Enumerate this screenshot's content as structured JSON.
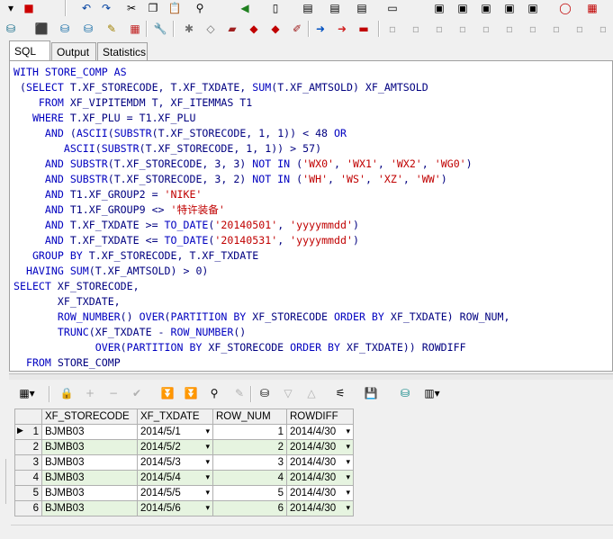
{
  "tabs": [
    "SQL",
    "Output",
    "Statistics"
  ],
  "active_tab": "SQL",
  "sql_lines": [
    [
      {
        "t": "WITH STORE_COMP AS",
        "c": "kw"
      }
    ],
    [
      {
        "t": " (",
        "c": "tx"
      },
      {
        "t": "SELECT",
        "c": "kw"
      },
      {
        "t": " T.XF_STORECODE, T.XF_TXDATE, ",
        "c": "tx"
      },
      {
        "t": "SUM",
        "c": "kw"
      },
      {
        "t": "(T.XF_AMTSOLD) XF_AMTSOLD",
        "c": "tx"
      }
    ],
    [
      {
        "t": "    FROM",
        "c": "kw"
      },
      {
        "t": " XF_VIPITEMDM T, XF_ITEMMAS T1",
        "c": "tx"
      }
    ],
    [
      {
        "t": "   WHERE",
        "c": "kw"
      },
      {
        "t": " T.XF_PLU = T1.XF_PLU",
        "c": "tx"
      }
    ],
    [
      {
        "t": "     AND",
        "c": "kw"
      },
      {
        "t": " (",
        "c": "tx"
      },
      {
        "t": "ASCII",
        "c": "kw"
      },
      {
        "t": "(",
        "c": "tx"
      },
      {
        "t": "SUBSTR",
        "c": "kw"
      },
      {
        "t": "(T.XF_STORECODE, 1, 1)) < 48 ",
        "c": "tx"
      },
      {
        "t": "OR",
        "c": "kw"
      }
    ],
    [
      {
        "t": "        ASCII",
        "c": "kw"
      },
      {
        "t": "(",
        "c": "tx"
      },
      {
        "t": "SUBSTR",
        "c": "kw"
      },
      {
        "t": "(T.XF_STORECODE, 1, 1)) > 57)",
        "c": "tx"
      }
    ],
    [
      {
        "t": "     AND",
        "c": "kw"
      },
      {
        "t": " ",
        "c": "tx"
      },
      {
        "t": "SUBSTR",
        "c": "kw"
      },
      {
        "t": "(T.XF_STORECODE, 3, 3) ",
        "c": "tx"
      },
      {
        "t": "NOT IN",
        "c": "kw"
      },
      {
        "t": " (",
        "c": "tx"
      },
      {
        "t": "'WX0'",
        "c": "st"
      },
      {
        "t": ", ",
        "c": "tx"
      },
      {
        "t": "'WX1'",
        "c": "st"
      },
      {
        "t": ", ",
        "c": "tx"
      },
      {
        "t": "'WX2'",
        "c": "st"
      },
      {
        "t": ", ",
        "c": "tx"
      },
      {
        "t": "'WG0'",
        "c": "st"
      },
      {
        "t": ")",
        "c": "tx"
      }
    ],
    [
      {
        "t": "     AND",
        "c": "kw"
      },
      {
        "t": " ",
        "c": "tx"
      },
      {
        "t": "SUBSTR",
        "c": "kw"
      },
      {
        "t": "(T.XF_STORECODE, 3, 2) ",
        "c": "tx"
      },
      {
        "t": "NOT IN",
        "c": "kw"
      },
      {
        "t": " (",
        "c": "tx"
      },
      {
        "t": "'WH'",
        "c": "st"
      },
      {
        "t": ", ",
        "c": "tx"
      },
      {
        "t": "'WS'",
        "c": "st"
      },
      {
        "t": ", ",
        "c": "tx"
      },
      {
        "t": "'XZ'",
        "c": "st"
      },
      {
        "t": ", ",
        "c": "tx"
      },
      {
        "t": "'WW'",
        "c": "st"
      },
      {
        "t": ")",
        "c": "tx"
      }
    ],
    [
      {
        "t": "     AND",
        "c": "kw"
      },
      {
        "t": " T1.XF_GROUP2 = ",
        "c": "tx"
      },
      {
        "t": "'NIKE'",
        "c": "st"
      }
    ],
    [
      {
        "t": "     AND",
        "c": "kw"
      },
      {
        "t": " T1.XF_GROUP9 <> ",
        "c": "tx"
      },
      {
        "t": "'特许装备'",
        "c": "st"
      }
    ],
    [
      {
        "t": "     AND",
        "c": "kw"
      },
      {
        "t": " T.XF_TXDATE >= ",
        "c": "tx"
      },
      {
        "t": "TO_DATE",
        "c": "kw"
      },
      {
        "t": "(",
        "c": "tx"
      },
      {
        "t": "'20140501'",
        "c": "st"
      },
      {
        "t": ", ",
        "c": "tx"
      },
      {
        "t": "'yyyymmdd'",
        "c": "st"
      },
      {
        "t": ")",
        "c": "tx"
      }
    ],
    [
      {
        "t": "     AND",
        "c": "kw"
      },
      {
        "t": " T.XF_TXDATE <= ",
        "c": "tx"
      },
      {
        "t": "TO_DATE",
        "c": "kw"
      },
      {
        "t": "(",
        "c": "tx"
      },
      {
        "t": "'20140531'",
        "c": "st"
      },
      {
        "t": ", ",
        "c": "tx"
      },
      {
        "t": "'yyyymmdd'",
        "c": "st"
      },
      {
        "t": ")",
        "c": "tx"
      }
    ],
    [
      {
        "t": "   GROUP BY",
        "c": "kw"
      },
      {
        "t": " T.XF_STORECODE, T.XF_TXDATE",
        "c": "tx"
      }
    ],
    [
      {
        "t": "  HAVING",
        "c": "kw"
      },
      {
        "t": " ",
        "c": "tx"
      },
      {
        "t": "SUM",
        "c": "kw"
      },
      {
        "t": "(T.XF_AMTSOLD) > 0)",
        "c": "tx"
      }
    ],
    [
      {
        "t": "SELECT",
        "c": "kw"
      },
      {
        "t": " XF_STORECODE,",
        "c": "tx"
      }
    ],
    [
      {
        "t": "       XF_TXDATE,",
        "c": "tx"
      }
    ],
    [
      {
        "t": "       ROW_NUMBER",
        "c": "kw"
      },
      {
        "t": "() ",
        "c": "tx"
      },
      {
        "t": "OVER",
        "c": "kw"
      },
      {
        "t": "(",
        "c": "tx"
      },
      {
        "t": "PARTITION BY",
        "c": "kw"
      },
      {
        "t": " XF_STORECODE ",
        "c": "tx"
      },
      {
        "t": "ORDER BY",
        "c": "kw"
      },
      {
        "t": " XF_TXDATE) ROW_NUM,",
        "c": "tx"
      }
    ],
    [
      {
        "t": "       TRUNC",
        "c": "kw"
      },
      {
        "t": "(XF_TXDATE - ",
        "c": "tx"
      },
      {
        "t": "ROW_NUMBER",
        "c": "kw"
      },
      {
        "t": "()",
        "c": "tx"
      }
    ],
    [
      {
        "t": "             OVER",
        "c": "kw"
      },
      {
        "t": "(",
        "c": "tx"
      },
      {
        "t": "PARTITION BY",
        "c": "kw"
      },
      {
        "t": " XF_STORECODE ",
        "c": "tx"
      },
      {
        "t": "ORDER BY",
        "c": "kw"
      },
      {
        "t": " XF_TXDATE)) ROWDIFF",
        "c": "tx"
      }
    ],
    [
      {
        "t": "  FROM",
        "c": "kw"
      },
      {
        "t": " STORE_COMP",
        "c": "tx"
      }
    ]
  ],
  "grid": {
    "columns": [
      "XF_STORECODE",
      "XF_TXDATE",
      "ROW_NUM",
      "ROWDIFF"
    ],
    "rows": [
      {
        "n": "1",
        "store": "BJMB03",
        "date": "2014/5/1",
        "row_num": "1",
        "rowdiff": "2014/4/30"
      },
      {
        "n": "2",
        "store": "BJMB03",
        "date": "2014/5/2",
        "row_num": "2",
        "rowdiff": "2014/4/30"
      },
      {
        "n": "3",
        "store": "BJMB03",
        "date": "2014/5/3",
        "row_num": "3",
        "rowdiff": "2014/4/30"
      },
      {
        "n": "4",
        "store": "BJMB03",
        "date": "2014/5/4",
        "row_num": "4",
        "rowdiff": "2014/4/30"
      },
      {
        "n": "5",
        "store": "BJMB03",
        "date": "2014/5/5",
        "row_num": "5",
        "rowdiff": "2014/4/30"
      },
      {
        "n": "6",
        "store": "BJMB03",
        "date": "2014/5/6",
        "row_num": "6",
        "rowdiff": "2014/4/30"
      }
    ]
  },
  "top_toolbar_icons": [
    "undo-icon",
    "redo-icon",
    "cut-icon",
    "copy-icon",
    "paste-icon",
    "find-icon",
    "replace-icon",
    "back-icon",
    "forward-icon",
    "new-icon",
    "explain-icon",
    "execute-icon"
  ],
  "results_toolbar_icons": [
    "grid-select-icon",
    "lock-icon",
    "add-row-icon",
    "delete-row-icon",
    "post-icon",
    "next-record-icon",
    "last-record-icon",
    "find-icon",
    "clear-icon",
    "fetch-icon",
    "filter-down-icon",
    "filter-up-icon",
    "tree-icon",
    "save-icon",
    "export-icon",
    "chart-icon"
  ]
}
